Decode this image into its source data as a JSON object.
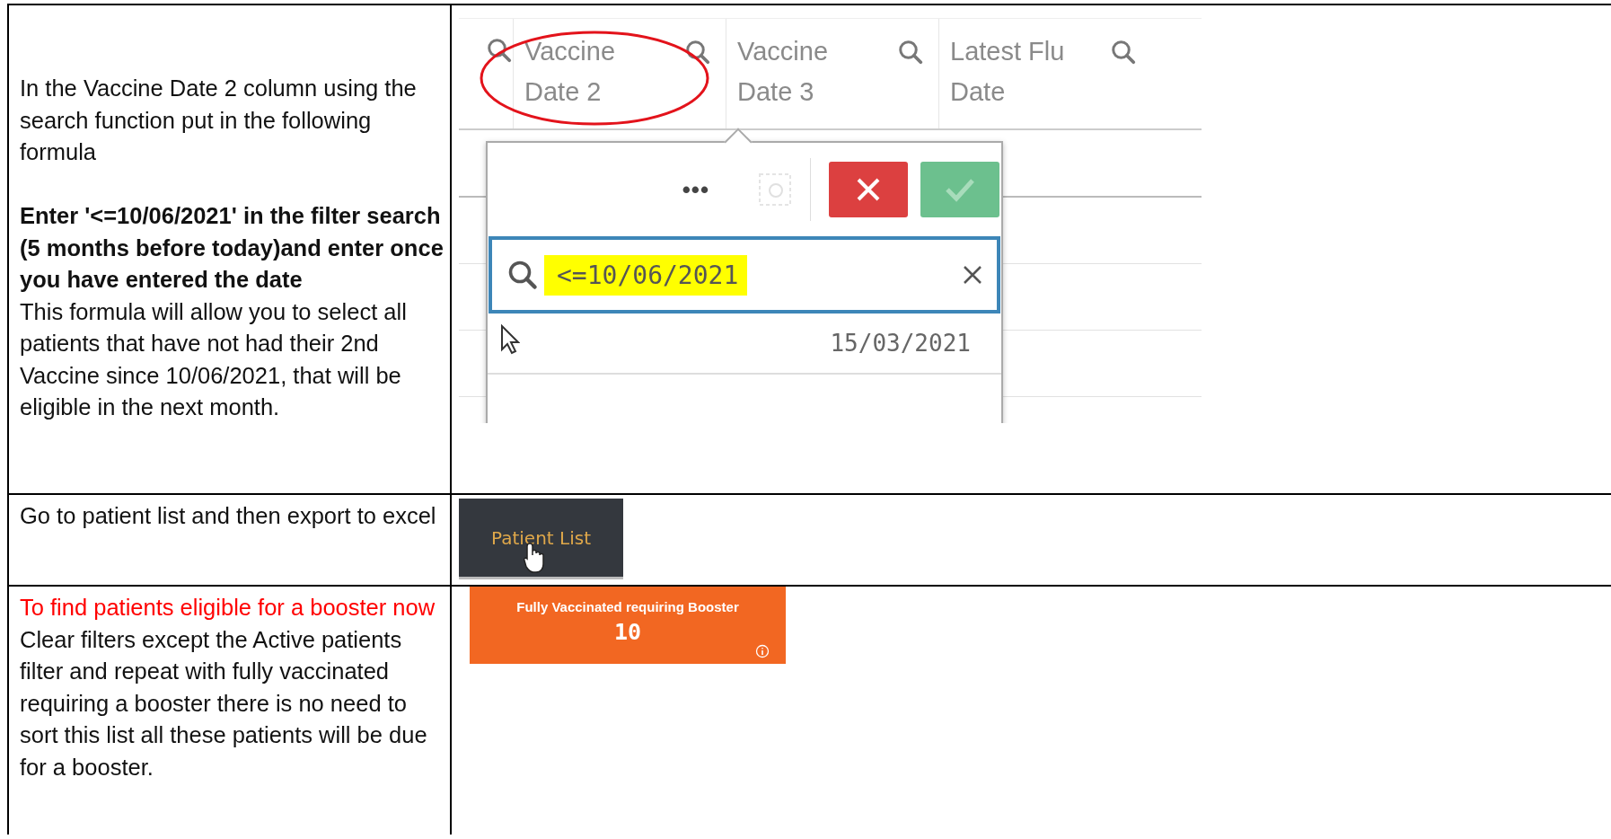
{
  "rows": [
    {
      "paragraphs": [
        {
          "kind": "plain",
          "text": "In the Vaccine Date 2 column using the search function put in the following formula"
        },
        {
          "kind": "gap"
        },
        {
          "kind": "bold",
          "text": "Enter '<=10/06/2021' in the filter search (5 months before today)and enter once you have entered the date"
        },
        {
          "kind": "plain",
          "text": "This formula will allow you to select all patients that have not had their 2nd Vaccine since 10/06/2021, that will be eligible in the next month."
        }
      ],
      "screenshot": {
        "kind": "filter",
        "columns": [
          "Vaccine Date 2",
          "Vaccine Date 3",
          "Latest Flu Date"
        ],
        "popup": {
          "more": "•••",
          "search_value": "<=10/06/2021",
          "list_items": [
            "15/03/2021"
          ]
        }
      }
    },
    {
      "paragraphs": [
        {
          "kind": "plain",
          "text": "Go to patient list and then export to excel"
        }
      ],
      "screenshot": {
        "kind": "button",
        "label": "Patient List"
      }
    },
    {
      "paragraphs": [
        {
          "kind": "heading",
          "text": "To find patients eligible for a booster now"
        },
        {
          "kind": "plain",
          "text": "Clear filters except the Active patients filter and repeat with fully vaccinated requiring a booster there is no need to sort this list all these patients will be due for a booster."
        }
      ],
      "screenshot": {
        "kind": "kpi",
        "title": "Fully Vaccinated requiring Booster",
        "value": "10"
      }
    }
  ]
}
